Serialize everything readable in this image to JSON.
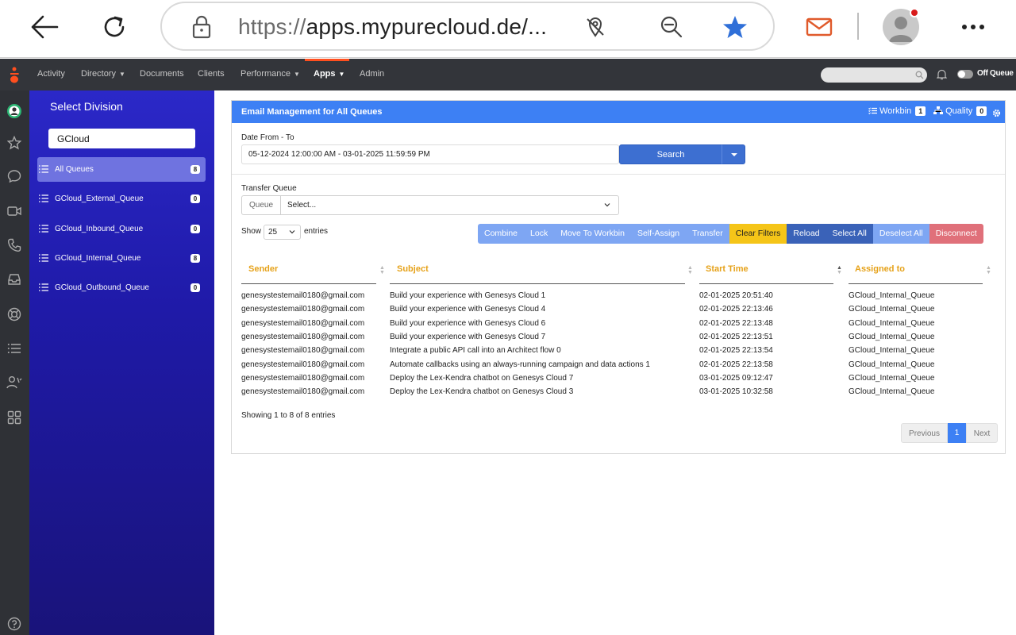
{
  "browser": {
    "url_scheme": "https://",
    "url_host": "apps.mypurecloud.de/..."
  },
  "nav": {
    "items": [
      "Activity",
      "Directory",
      "Documents",
      "Clients",
      "Performance",
      "Apps",
      "Admin"
    ],
    "status_label": "Off Queue"
  },
  "division": {
    "title": "Select Division",
    "search_value": "GCloud",
    "queues": [
      {
        "label": "All Queues",
        "count": "8"
      },
      {
        "label": "GCloud_External_Queue",
        "count": "0"
      },
      {
        "label": "GCloud_Inbound_Queue",
        "count": "0"
      },
      {
        "label": "GCloud_Internal_Queue",
        "count": "8"
      },
      {
        "label": "GCloud_Outbound_Queue",
        "count": "0"
      }
    ]
  },
  "panel": {
    "title": "Email Management for All Queues",
    "workbin_label": "Workbin",
    "workbin_count": "1",
    "quality_label": "Quality",
    "quality_count": "0",
    "date_label": "Date From - To",
    "date_value": "05-12-2024 12:00:00 AM - 03-01-2025 11:59:59 PM",
    "search_label": "Search",
    "transfer_label": "Transfer Queue",
    "queue_tag": "Queue",
    "queue_select": "Select...",
    "show_label": "Show",
    "entries_value": "25",
    "entries_label": "entries",
    "actions": [
      "Combine",
      "Lock",
      "Move To Workbin",
      "Self-Assign",
      "Transfer",
      "Clear Filters",
      "Reload",
      "Select All",
      "Deselect All",
      "Disconnect"
    ],
    "columns": [
      "Sender",
      "Subject",
      "Start Time",
      "Assigned to"
    ],
    "rows": [
      {
        "sender": "genesystestemail0180@gmail.com",
        "subject": "Build your experience with Genesys Cloud 1",
        "start": "02-01-2025 20:51:40",
        "assigned": "GCloud_Internal_Queue"
      },
      {
        "sender": "genesystestemail0180@gmail.com",
        "subject": "Build your experience with Genesys Cloud 4",
        "start": "02-01-2025 22:13:46",
        "assigned": "GCloud_Internal_Queue"
      },
      {
        "sender": "genesystestemail0180@gmail.com",
        "subject": "Build your experience with Genesys Cloud 6",
        "start": "02-01-2025 22:13:48",
        "assigned": "GCloud_Internal_Queue"
      },
      {
        "sender": "genesystestemail0180@gmail.com",
        "subject": "Build your experience with Genesys Cloud 7",
        "start": "02-01-2025 22:13:51",
        "assigned": "GCloud_Internal_Queue"
      },
      {
        "sender": "genesystestemail0180@gmail.com",
        "subject": "Integrate a public API call into an Architect flow 0",
        "start": "02-01-2025 22:13:54",
        "assigned": "GCloud_Internal_Queue"
      },
      {
        "sender": "genesystestemail0180@gmail.com",
        "subject": "Automate callbacks using an always-running campaign and data actions 1",
        "start": "02-01-2025 22:13:58",
        "assigned": "GCloud_Internal_Queue"
      },
      {
        "sender": "genesystestemail0180@gmail.com",
        "subject": "Deploy the Lex-Kendra chatbot on Genesys Cloud 7",
        "start": "03-01-2025 09:12:47",
        "assigned": "GCloud_Internal_Queue"
      },
      {
        "sender": "genesystestemail0180@gmail.com",
        "subject": "Deploy the Lex-Kendra chatbot on Genesys Cloud 3",
        "start": "03-01-2025 10:32:58",
        "assigned": "GCloud_Internal_Queue"
      }
    ],
    "showing_text": "Showing 1 to 8 of 8 entries",
    "pager": {
      "prev": "Previous",
      "page": "1",
      "next": "Next"
    }
  },
  "colors": {
    "accent": "#3d80f4",
    "nav_bg": "#33353a",
    "division_bg": "#1f1aa8",
    "header_text": "#e6a21a",
    "clear_filters": "#f5c518",
    "disconnect": "#e0707a"
  }
}
